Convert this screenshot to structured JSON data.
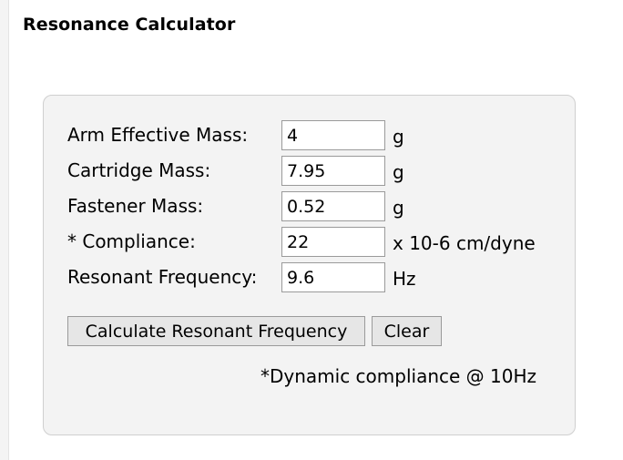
{
  "app": {
    "title": "Resonance Calculator"
  },
  "form": {
    "rows": [
      {
        "label": "Arm Effective Mass:",
        "value": "4",
        "unit": "g"
      },
      {
        "label": "Cartridge Mass:",
        "value": "7.95",
        "unit": "g"
      },
      {
        "label": "Fastener Mass:",
        "value": "0.52",
        "unit": "g"
      },
      {
        "label": "* Compliance:",
        "value": "22",
        "unit": "x 10-6 cm/dyne"
      },
      {
        "label": "Resonant Frequency:",
        "value": "9.6",
        "unit": "Hz"
      }
    ],
    "buttons": {
      "calculate": "Calculate Resonant Frequency",
      "clear": "Clear"
    },
    "footnote": "*Dynamic compliance @ 10Hz"
  }
}
